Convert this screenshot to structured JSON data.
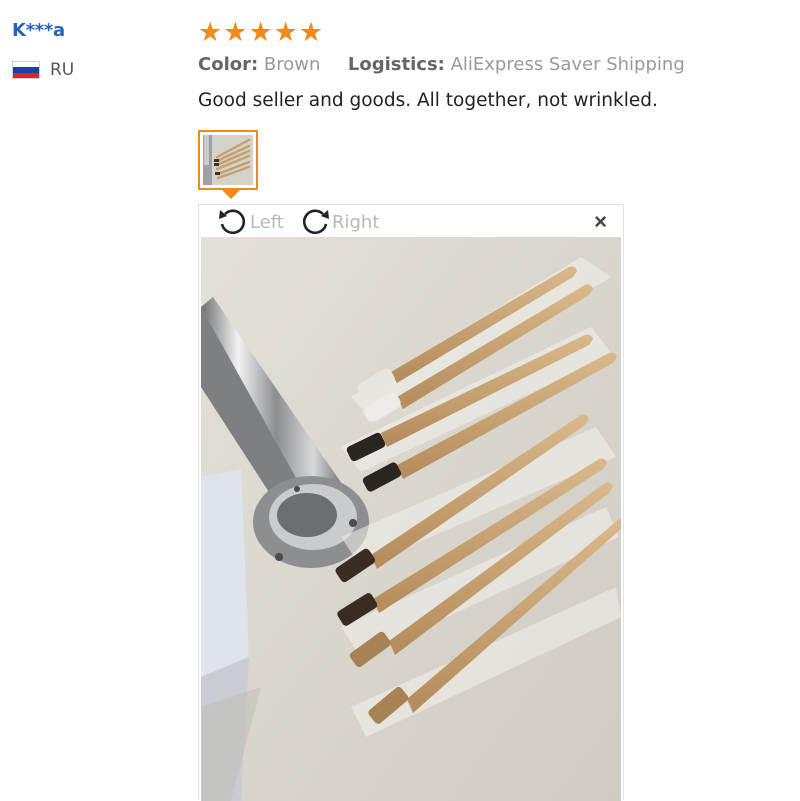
{
  "buyer": {
    "name": "K***a",
    "country_code": "RU",
    "flag_colors": [
      "#ffffff",
      "#1c3fa8",
      "#d52b1e"
    ]
  },
  "review": {
    "rating": 5,
    "rating_max": 5,
    "star_glyph": "★",
    "star_color": "#f08a18",
    "color_label": "Color:",
    "color_value": "Brown",
    "logistics_label": "Logistics:",
    "logistics_value": "AliExpress Saver Shipping",
    "text": "Good seller and goods. All together, not wrinkled."
  },
  "viewer": {
    "rotate_left_label": "Left",
    "rotate_right_label": "Right",
    "close_glyph": "×",
    "rotate_left_icon": "rotate-left-icon",
    "rotate_right_icon": "rotate-right-icon"
  },
  "photo": {
    "subject": "bamboo-toothbrushes",
    "bristle_colors": [
      "#e8e4df",
      "#e8e4df",
      "#2b2520",
      "#2b2520",
      "#3a2c22",
      "#3a2c22",
      "#a78255",
      "#a78255"
    ]
  }
}
